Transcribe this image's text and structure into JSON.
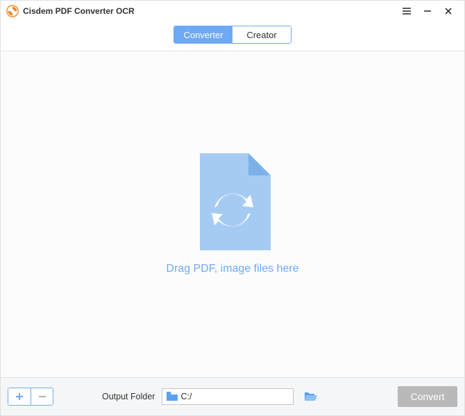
{
  "app": {
    "title": "Cisdem PDF Converter OCR"
  },
  "tabs": {
    "converter": "Converter",
    "creator": "Creator"
  },
  "dropzone": {
    "hint": "Drag PDF, image files here"
  },
  "footer": {
    "output_label": "Output Folder",
    "output_path": "C:/",
    "convert_label": "Convert"
  },
  "colors": {
    "accent": "#6ea9f6"
  }
}
